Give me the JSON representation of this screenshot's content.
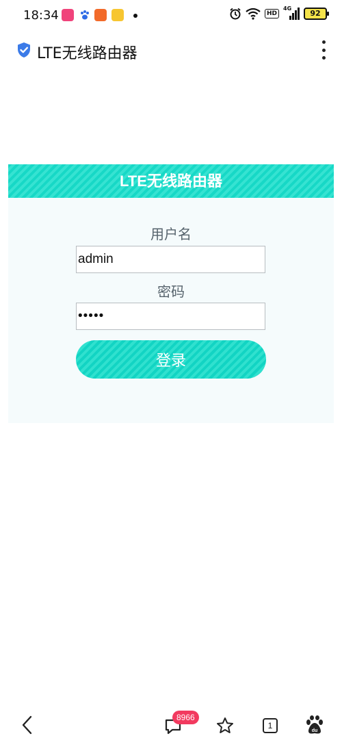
{
  "status_bar": {
    "time": "18:34",
    "network_label": "HD",
    "signal_label": "4G",
    "battery_level": "92"
  },
  "browser": {
    "page_title": "LTE无线路由器"
  },
  "login": {
    "banner_title": "LTE无线路由器",
    "username_label": "用户名",
    "username_value": "admin",
    "password_label": "密码",
    "password_value": "•••••",
    "login_button": "登录"
  },
  "bottom_nav": {
    "comments_badge": "8966",
    "tabs_count": "1"
  },
  "colors": {
    "accent": "#17d8c6",
    "badge": "#f23a5f",
    "shield": "#3b7be8"
  }
}
